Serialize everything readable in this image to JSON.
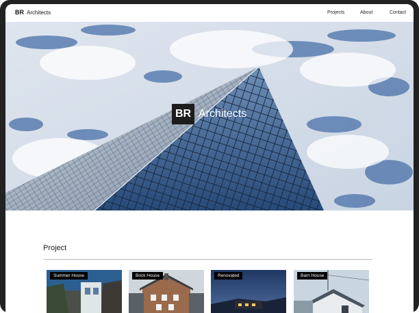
{
  "brand": {
    "logo_text": "BR",
    "name": "Architects"
  },
  "nav": {
    "projects": "Projects",
    "about": "About",
    "contact": "Contact"
  },
  "hero": {
    "logo_text": "BR",
    "name": "Architects"
  },
  "section": {
    "title": "Project"
  },
  "projects": [
    {
      "label": "Summer House"
    },
    {
      "label": "Brick House"
    },
    {
      "label": "Renovated"
    },
    {
      "label": "Barn House"
    }
  ]
}
